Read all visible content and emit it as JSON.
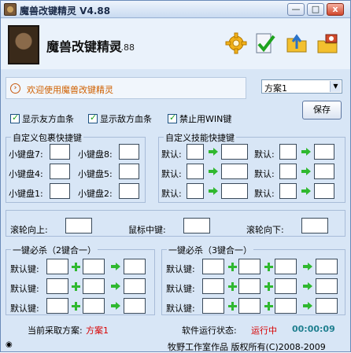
{
  "window": {
    "title": "魔兽改键精灵 V4.88",
    "controls": [
      "—",
      "□",
      "x"
    ]
  },
  "header": {
    "brand_title": "魔兽改键精灵",
    "brand_version": "V4.88",
    "toolbar_icons": [
      "gear-icon",
      "check-icon",
      "folder-icon",
      "camera-icon"
    ]
  },
  "welcome": {
    "text": "欢迎使用魔兽改键精灵"
  },
  "scheme": {
    "selected": "方案1",
    "save_label": "保存"
  },
  "checkboxes": [
    {
      "label": "显示友方血条",
      "checked": true
    },
    {
      "label": "显示敌方血条",
      "checked": true
    },
    {
      "label": "禁止用WIN键",
      "checked": true
    }
  ],
  "inventory": {
    "title": "自定义包裹快捷键",
    "labels": [
      "小键盘7:",
      "小键盘8:",
      "小键盘4:",
      "小键盘5:",
      "小键盘1:",
      "小键盘2:"
    ]
  },
  "skills": {
    "title": "自定义技能快捷键",
    "default_label": "默认:"
  },
  "mouse": {
    "wheel_up": "滚轮向上:",
    "middle": "鼠标中键:",
    "wheel_down": "滚轮向下:"
  },
  "combo2": {
    "title": "一键必杀（2键合一）",
    "default_label": "默认键:"
  },
  "combo3": {
    "title": "一键必杀（3键合一）",
    "default_label": "默认键:"
  },
  "status": {
    "scheme_label": "当前采取方案:",
    "scheme_value": "方案1",
    "run_label": "软件运行状态:",
    "run_value": "运行中",
    "timer": "00:00:09"
  },
  "footer": {
    "copyright": "牧野工作室作品 版权所有(C)2008-2009"
  },
  "colors": {
    "accent_orange": "#d06000",
    "status_red": "#d80000",
    "timer_teal": "#1f7f8f",
    "arrow_green": "#2fb82f"
  }
}
